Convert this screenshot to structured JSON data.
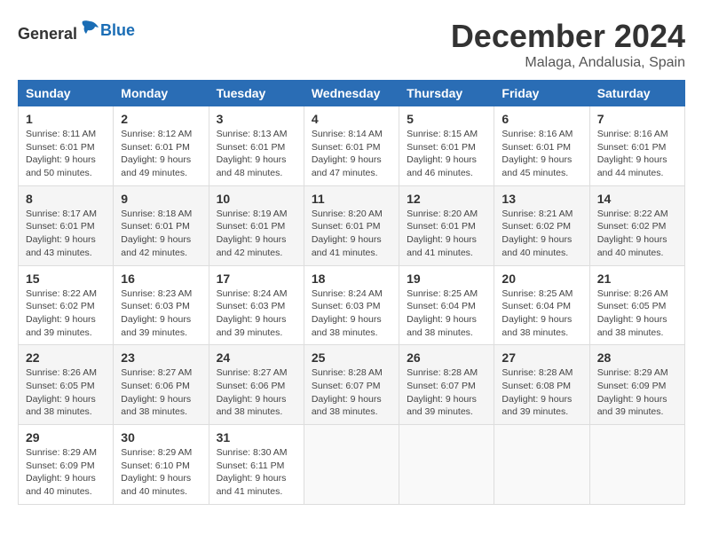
{
  "header": {
    "logo": {
      "text_general": "General",
      "text_blue": "Blue"
    },
    "month": "December 2024",
    "location": "Malaga, Andalusia, Spain"
  },
  "days_of_week": [
    "Sunday",
    "Monday",
    "Tuesday",
    "Wednesday",
    "Thursday",
    "Friday",
    "Saturday"
  ],
  "weeks": [
    [
      {
        "day": "1",
        "sunrise": "Sunrise: 8:11 AM",
        "sunset": "Sunset: 6:01 PM",
        "daylight": "Daylight: 9 hours and 50 minutes."
      },
      {
        "day": "2",
        "sunrise": "Sunrise: 8:12 AM",
        "sunset": "Sunset: 6:01 PM",
        "daylight": "Daylight: 9 hours and 49 minutes."
      },
      {
        "day": "3",
        "sunrise": "Sunrise: 8:13 AM",
        "sunset": "Sunset: 6:01 PM",
        "daylight": "Daylight: 9 hours and 48 minutes."
      },
      {
        "day": "4",
        "sunrise": "Sunrise: 8:14 AM",
        "sunset": "Sunset: 6:01 PM",
        "daylight": "Daylight: 9 hours and 47 minutes."
      },
      {
        "day": "5",
        "sunrise": "Sunrise: 8:15 AM",
        "sunset": "Sunset: 6:01 PM",
        "daylight": "Daylight: 9 hours and 46 minutes."
      },
      {
        "day": "6",
        "sunrise": "Sunrise: 8:16 AM",
        "sunset": "Sunset: 6:01 PM",
        "daylight": "Daylight: 9 hours and 45 minutes."
      },
      {
        "day": "7",
        "sunrise": "Sunrise: 8:16 AM",
        "sunset": "Sunset: 6:01 PM",
        "daylight": "Daylight: 9 hours and 44 minutes."
      }
    ],
    [
      {
        "day": "8",
        "sunrise": "Sunrise: 8:17 AM",
        "sunset": "Sunset: 6:01 PM",
        "daylight": "Daylight: 9 hours and 43 minutes."
      },
      {
        "day": "9",
        "sunrise": "Sunrise: 8:18 AM",
        "sunset": "Sunset: 6:01 PM",
        "daylight": "Daylight: 9 hours and 42 minutes."
      },
      {
        "day": "10",
        "sunrise": "Sunrise: 8:19 AM",
        "sunset": "Sunset: 6:01 PM",
        "daylight": "Daylight: 9 hours and 42 minutes."
      },
      {
        "day": "11",
        "sunrise": "Sunrise: 8:20 AM",
        "sunset": "Sunset: 6:01 PM",
        "daylight": "Daylight: 9 hours and 41 minutes."
      },
      {
        "day": "12",
        "sunrise": "Sunrise: 8:20 AM",
        "sunset": "Sunset: 6:01 PM",
        "daylight": "Daylight: 9 hours and 41 minutes."
      },
      {
        "day": "13",
        "sunrise": "Sunrise: 8:21 AM",
        "sunset": "Sunset: 6:02 PM",
        "daylight": "Daylight: 9 hours and 40 minutes."
      },
      {
        "day": "14",
        "sunrise": "Sunrise: 8:22 AM",
        "sunset": "Sunset: 6:02 PM",
        "daylight": "Daylight: 9 hours and 40 minutes."
      }
    ],
    [
      {
        "day": "15",
        "sunrise": "Sunrise: 8:22 AM",
        "sunset": "Sunset: 6:02 PM",
        "daylight": "Daylight: 9 hours and 39 minutes."
      },
      {
        "day": "16",
        "sunrise": "Sunrise: 8:23 AM",
        "sunset": "Sunset: 6:03 PM",
        "daylight": "Daylight: 9 hours and 39 minutes."
      },
      {
        "day": "17",
        "sunrise": "Sunrise: 8:24 AM",
        "sunset": "Sunset: 6:03 PM",
        "daylight": "Daylight: 9 hours and 39 minutes."
      },
      {
        "day": "18",
        "sunrise": "Sunrise: 8:24 AM",
        "sunset": "Sunset: 6:03 PM",
        "daylight": "Daylight: 9 hours and 38 minutes."
      },
      {
        "day": "19",
        "sunrise": "Sunrise: 8:25 AM",
        "sunset": "Sunset: 6:04 PM",
        "daylight": "Daylight: 9 hours and 38 minutes."
      },
      {
        "day": "20",
        "sunrise": "Sunrise: 8:25 AM",
        "sunset": "Sunset: 6:04 PM",
        "daylight": "Daylight: 9 hours and 38 minutes."
      },
      {
        "day": "21",
        "sunrise": "Sunrise: 8:26 AM",
        "sunset": "Sunset: 6:05 PM",
        "daylight": "Daylight: 9 hours and 38 minutes."
      }
    ],
    [
      {
        "day": "22",
        "sunrise": "Sunrise: 8:26 AM",
        "sunset": "Sunset: 6:05 PM",
        "daylight": "Daylight: 9 hours and 38 minutes."
      },
      {
        "day": "23",
        "sunrise": "Sunrise: 8:27 AM",
        "sunset": "Sunset: 6:06 PM",
        "daylight": "Daylight: 9 hours and 38 minutes."
      },
      {
        "day": "24",
        "sunrise": "Sunrise: 8:27 AM",
        "sunset": "Sunset: 6:06 PM",
        "daylight": "Daylight: 9 hours and 38 minutes."
      },
      {
        "day": "25",
        "sunrise": "Sunrise: 8:28 AM",
        "sunset": "Sunset: 6:07 PM",
        "daylight": "Daylight: 9 hours and 38 minutes."
      },
      {
        "day": "26",
        "sunrise": "Sunrise: 8:28 AM",
        "sunset": "Sunset: 6:07 PM",
        "daylight": "Daylight: 9 hours and 39 minutes."
      },
      {
        "day": "27",
        "sunrise": "Sunrise: 8:28 AM",
        "sunset": "Sunset: 6:08 PM",
        "daylight": "Daylight: 9 hours and 39 minutes."
      },
      {
        "day": "28",
        "sunrise": "Sunrise: 8:29 AM",
        "sunset": "Sunset: 6:09 PM",
        "daylight": "Daylight: 9 hours and 39 minutes."
      }
    ],
    [
      {
        "day": "29",
        "sunrise": "Sunrise: 8:29 AM",
        "sunset": "Sunset: 6:09 PM",
        "daylight": "Daylight: 9 hours and 40 minutes."
      },
      {
        "day": "30",
        "sunrise": "Sunrise: 8:29 AM",
        "sunset": "Sunset: 6:10 PM",
        "daylight": "Daylight: 9 hours and 40 minutes."
      },
      {
        "day": "31",
        "sunrise": "Sunrise: 8:30 AM",
        "sunset": "Sunset: 6:11 PM",
        "daylight": "Daylight: 9 hours and 41 minutes."
      },
      null,
      null,
      null,
      null
    ]
  ]
}
